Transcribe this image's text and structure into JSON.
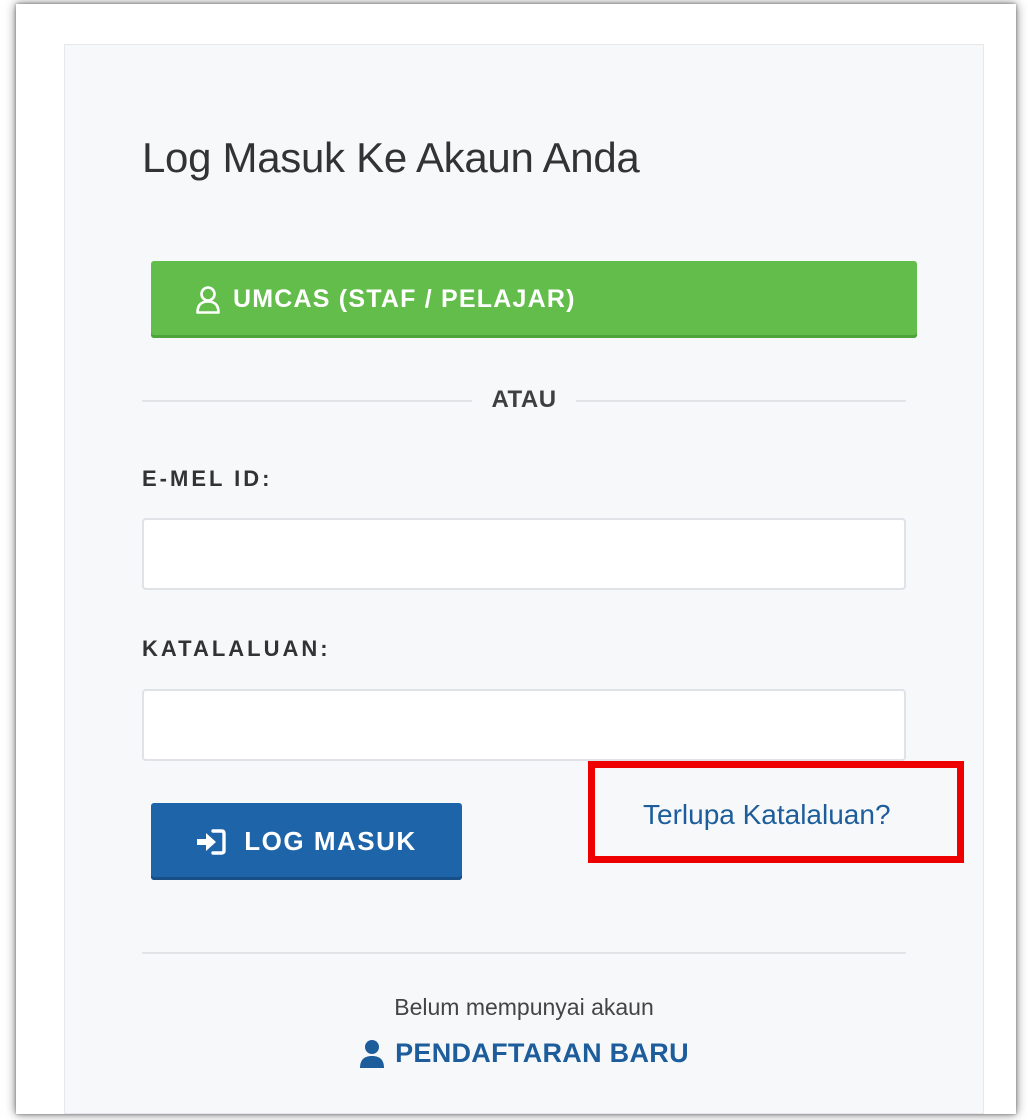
{
  "login": {
    "title": "Log Masuk Ke Akaun Anda",
    "umcas_button": {
      "label": "UMCAS (STAF / PELAJAR)",
      "icon": "user-outline-icon",
      "color": "#62bd4b"
    },
    "divider_text": "ATAU",
    "email": {
      "label": "E-MEL ID:",
      "value": "",
      "placeholder": ""
    },
    "password": {
      "label": "KATALALUAN:",
      "value": "",
      "placeholder": ""
    },
    "submit_button": {
      "label": "LOG MASUK",
      "icon": "sign-in-icon",
      "color": "#1e64a8"
    },
    "forgot_password_link": "Terlupa Katalaluan?",
    "highlight_color": "#ee0000",
    "no_account_text": "Belum mempunyai akaun",
    "register_link": {
      "label": "PENDAFTARAN BARU",
      "icon": "user-icon"
    },
    "link_color": "#1d5d9b"
  }
}
